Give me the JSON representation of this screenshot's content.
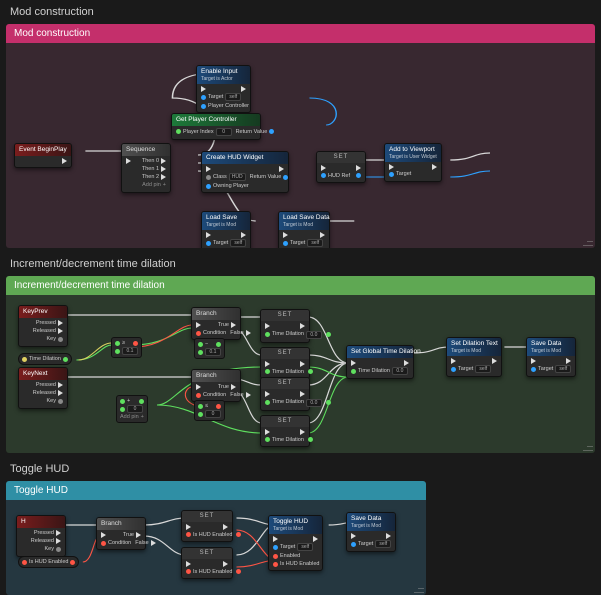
{
  "sections": {
    "mod": {
      "outer_title": "Mod construction",
      "header": "Mod construction",
      "nodes": {
        "begin": {
          "title": "Event BeginPlay"
        },
        "seq": {
          "title": "Sequence",
          "pins": [
            "Then 0",
            "Then 1",
            "Then 2",
            "Add pin"
          ]
        },
        "enable": {
          "title": "Enable Input",
          "sub": "Target is Actor",
          "rows": [
            "Target",
            "Player Controller"
          ],
          "self": "self"
        },
        "getpc": {
          "title": "Get Player Controller",
          "rowL": "Player Index",
          "rowLval": "0",
          "rowR": "Return Value"
        },
        "create": {
          "title": "Create HUD Widget",
          "rowsL": [
            "Class",
            "Owning Player"
          ],
          "classVal": "HUD",
          "rowR": "Return Value"
        },
        "set": {
          "title": "SET",
          "row": "HUD Ref"
        },
        "addvp": {
          "title": "Add to Viewport",
          "sub": "Target is User Widget",
          "row": "Target"
        },
        "load": {
          "title": "Load Save",
          "sub": "Target is Mod",
          "rowL": "Target",
          "self": "self"
        },
        "loaddata": {
          "title": "Load Save Data",
          "sub": "Target is Mod",
          "rowL": "Target",
          "self": "self"
        }
      }
    },
    "time": {
      "outer_title": "Increment/decrement time dilation",
      "header": "Increment/decrement time dilation",
      "nodes": {
        "keyprev": {
          "title": "KeyPrev",
          "rows": [
            "Pressed",
            "Released",
            "Key"
          ]
        },
        "keynext": {
          "title": "KeyNext",
          "rows": [
            "Pressed",
            "Released",
            "Key"
          ]
        },
        "branch1": {
          "title": "Branch",
          "rowsL": [
            "Condition"
          ],
          "rowsR": [
            "True",
            "False"
          ]
        },
        "branch2": {
          "title": "Branch",
          "rowsL": [
            "Condition"
          ],
          "rowsR": [
            "True",
            "False"
          ]
        },
        "set1": {
          "title": "SET",
          "row": "Time Dilation",
          "val": "0.0"
        },
        "set2": {
          "title": "SET",
          "row": "Time Dilation"
        },
        "set3": {
          "title": "SET",
          "row": "Time Dilation",
          "val": "0.0"
        },
        "set4": {
          "title": "SET",
          "row": "Time Dilation"
        },
        "gte1": {
          "val": "0.1"
        },
        "add1": {
          "val": "0.1"
        },
        "lte1": {
          "val": "0"
        },
        "addpin": {
          "label": "Add pin"
        },
        "setgtd": {
          "title": "Set Global Time Dilation",
          "rowL": "Time Dilation",
          "rowLval": "0.0"
        },
        "settxt": {
          "title": "Set Dilation Text",
          "sub": "Target is Mod",
          "rowL": "Target",
          "self": "self"
        },
        "save": {
          "title": "Save Data",
          "sub": "Target is Mod",
          "rowL": "Target",
          "self": "self"
        }
      }
    },
    "hud": {
      "outer_title": "Toggle HUD",
      "header": "Toggle HUD",
      "nodes": {
        "keyh": {
          "title": "H",
          "rows": [
            "Pressed",
            "Released",
            "Key"
          ]
        },
        "branch": {
          "title": "Branch",
          "rowsL": [
            "Condition"
          ],
          "rowsR": [
            "True",
            "False"
          ]
        },
        "varhud": {
          "label": "Is HUD Enabled"
        },
        "set1": {
          "title": "SET",
          "row": "Is HUD Enabled"
        },
        "set2": {
          "title": "SET",
          "row": "Is HUD Enabled"
        },
        "toggle": {
          "title": "Toggle HUD",
          "sub": "Target is Mod",
          "rowsL": [
            "Target",
            "Enabled",
            "Is HUD Enabled"
          ],
          "self": "self"
        },
        "save": {
          "title": "Save Data",
          "sub": "Target is Mod",
          "rowL": "Target",
          "self": "self"
        }
      }
    }
  }
}
